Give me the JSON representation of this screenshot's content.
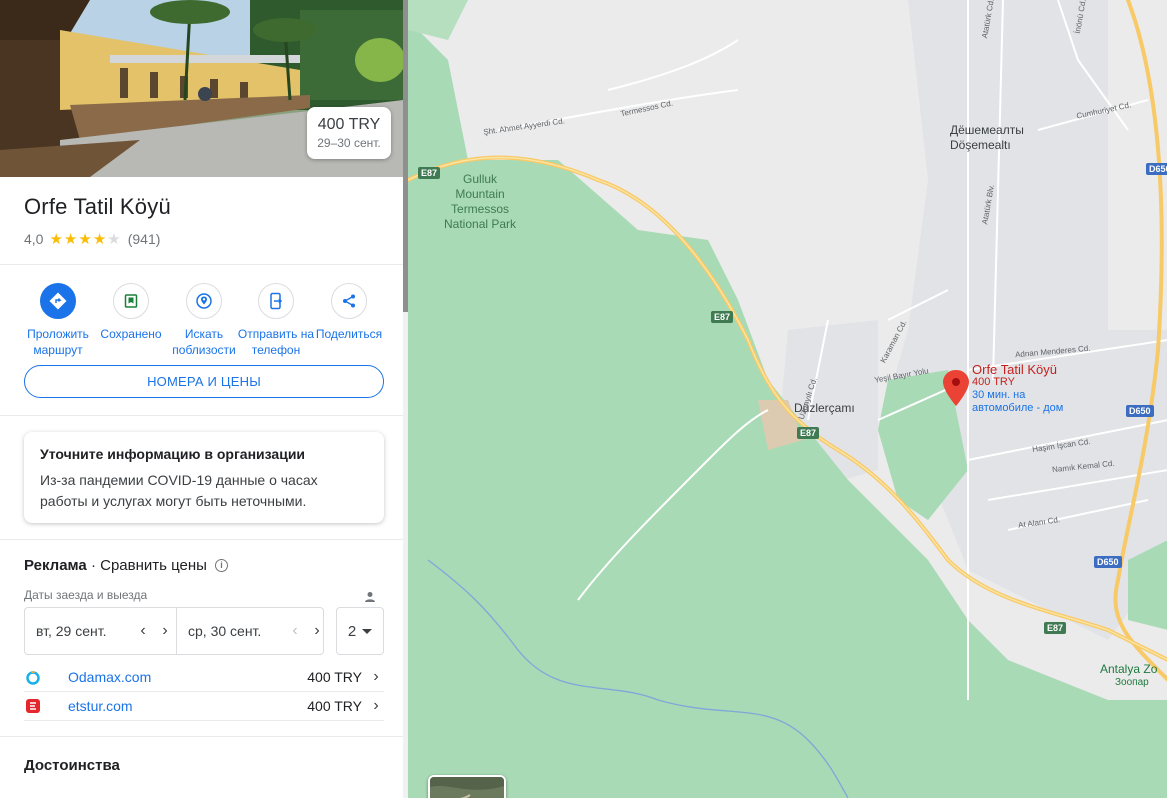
{
  "place": {
    "name": "Orfe Tatil Köyü",
    "rating": "4,0",
    "stars_filled": 4,
    "review_count": "(941)",
    "price": "400 TRY",
    "price_dates": "29–30 сент."
  },
  "actions": [
    {
      "label": "Проложить маршрут",
      "icon": "directions-icon"
    },
    {
      "label": "Сохранено",
      "icon": "bookmark-icon"
    },
    {
      "label": "Искать поблизости",
      "icon": "nearby-icon"
    },
    {
      "label": "Отправить на телефон",
      "icon": "send-to-phone-icon"
    },
    {
      "label": "Поделиться",
      "icon": "share-icon"
    }
  ],
  "rooms_button": "НОМЕРА И ЦЕНЫ",
  "notice": {
    "title": "Уточните информацию в организации",
    "body": "Из-за пандемии COVID-19 данные о часах работы и услугах могут быть неточными."
  },
  "ads": {
    "label": "Реклама",
    "separator": "·",
    "title": "Сравнить цены",
    "dates_label": "Даты заезда и выезда",
    "checkin": "вт, 29 сент.",
    "checkout": "ср, 30 сент.",
    "guests": "2",
    "offers": [
      {
        "site": "Odamax.com",
        "price": "400 TRY",
        "color": "#1ab0e8"
      },
      {
        "site": "etstur.com",
        "price": "400 TRY",
        "color": "#e5262d"
      }
    ]
  },
  "section_title": "Достоинства",
  "map": {
    "park_label": "Gulluk\nMountain\nTermessos\nNational Park",
    "pin": {
      "name": "Orfe Tatil Köyü",
      "price": "400 TRY",
      "travel_time": "30 мин. на",
      "travel_mode": "автомобиле - дом"
    },
    "places": [
      "Дёшемеалты",
      "Döşemealtı",
      "Düzlerçamı",
      "Antalya Zo",
      "Зоопар"
    ],
    "streets": [
      "Termessos Cd.",
      "Şht. Ahmet Ayyerdi Cd.",
      "Cumhuriyet Cd.",
      "Adnan Menderes Cd.",
      "Yeşil Bayır Yolu",
      "Karaman Cd.",
      "Uzunyılı Cd.",
      "Haşim İşcan Cd.",
      "Namık Kemal Cd.",
      "At Alanı Cd.",
      "Atatürk Blv.",
      "İnönü Cd.",
      "Atatürk Cd."
    ],
    "road_numbers": [
      "E87",
      "E87",
      "E87",
      "E87",
      "D650",
      "D650",
      "D650"
    ],
    "colors": {
      "park": "#a8dab5",
      "road": "#f8c967",
      "pin": "#ea4335",
      "urban": "#e8eaed"
    }
  }
}
